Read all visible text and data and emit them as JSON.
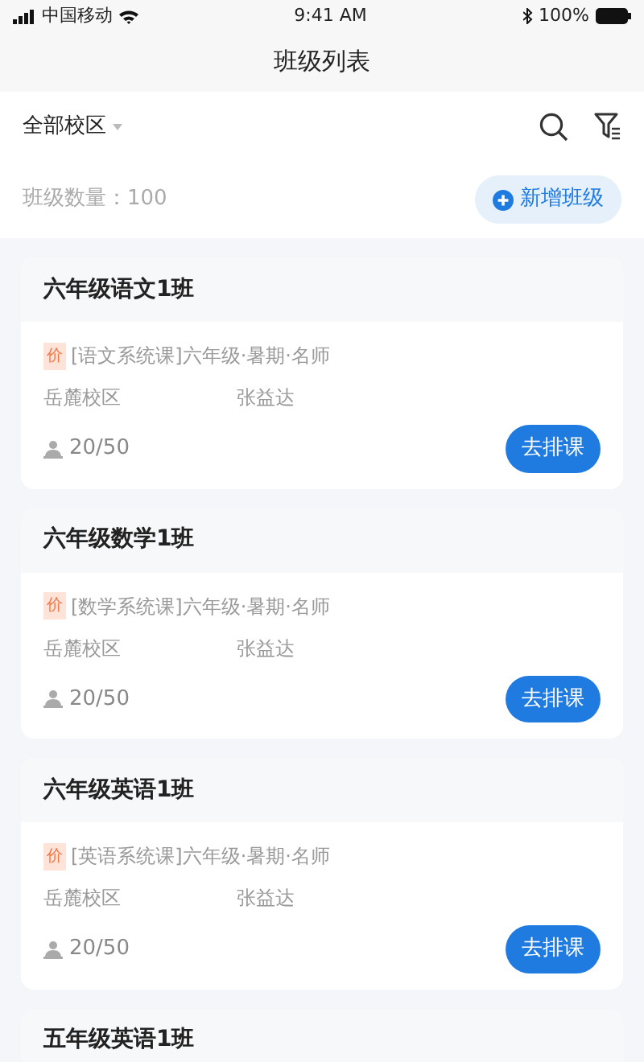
{
  "status_bar": {
    "carrier": "中国移动",
    "time": "9:41 AM",
    "battery": "100%"
  },
  "nav": {
    "title": "班级列表"
  },
  "filter": {
    "campus": "全部校区"
  },
  "summary": {
    "count": "班级数量：100",
    "add_button": "新增班级"
  },
  "classes": [
    {
      "name": "六年级语文1班",
      "tag": "价",
      "course": "[语文系统课]六年级·暑期·名师",
      "campus": "岳麓校区",
      "teacher": "张益达",
      "enrolled": "20/50",
      "action": "去排课"
    },
    {
      "name": "六年级数学1班",
      "tag": "价",
      "course": "[数学系统课]六年级·暑期·名师",
      "campus": "岳麓校区",
      "teacher": "张益达",
      "enrolled": "20/50",
      "action": "去排课"
    },
    {
      "name": "六年级英语1班",
      "tag": "价",
      "course": "[英语系统课]六年级·暑期·名师",
      "campus": "岳麓校区",
      "teacher": "张益达",
      "enrolled": "20/50",
      "action": "去排课"
    },
    {
      "name": "五年级英语1班"
    }
  ]
}
